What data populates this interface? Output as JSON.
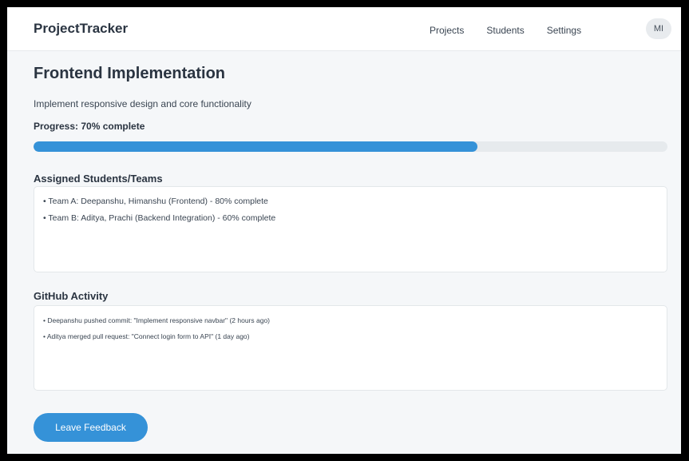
{
  "header": {
    "brand": "ProjectTracker",
    "nav": [
      "Projects",
      "Students",
      "Settings"
    ],
    "avatar_initials": "MI"
  },
  "project": {
    "title": "Frontend Implementation",
    "description": "Implement responsive design and core functionality",
    "progress_label": "Progress: 70% complete",
    "progress_percent": 70
  },
  "students": {
    "heading": "Assigned Students/Teams",
    "items": [
      "Team A: Deepanshu, Himanshu (Frontend) - 80% complete",
      "Team B: Aditya, Prachi (Backend Integration) - 60% complete"
    ]
  },
  "github": {
    "heading": "GitHub Activity",
    "items": [
      "Deepanshu pushed commit: \"Implement responsive navbar\" (2 hours ago)",
      "Aditya merged pull request: \"Connect login form to API\" (1 day ago)"
    ]
  },
  "actions": {
    "feedback_label": "Leave Feedback"
  },
  "colors": {
    "accent": "#3592d8",
    "progress_track": "#e6eaed",
    "text_dark": "#2a3441"
  }
}
